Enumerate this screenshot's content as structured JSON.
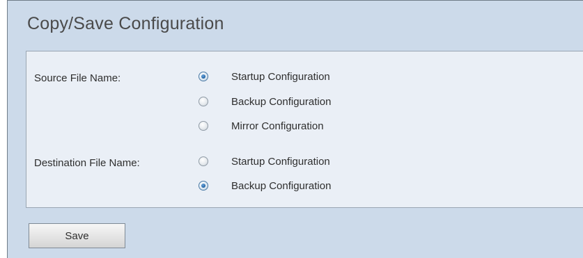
{
  "page": {
    "title": "Copy/Save Configuration"
  },
  "source": {
    "label": "Source File Name:",
    "options": [
      {
        "label": "Startup Configuration",
        "checked": true
      },
      {
        "label": "Backup Configuration",
        "checked": false
      },
      {
        "label": "Mirror Configuration",
        "checked": false
      }
    ]
  },
  "destination": {
    "label": "Destination File Name:",
    "options": [
      {
        "label": "Startup Configuration",
        "checked": false
      },
      {
        "label": "Backup Configuration",
        "checked": true
      }
    ]
  },
  "actions": {
    "save_label": "Save"
  },
  "colors": {
    "background": "#ccdaea",
    "panel": "#eaeff6",
    "radio_selected": "#1e5f9e"
  }
}
